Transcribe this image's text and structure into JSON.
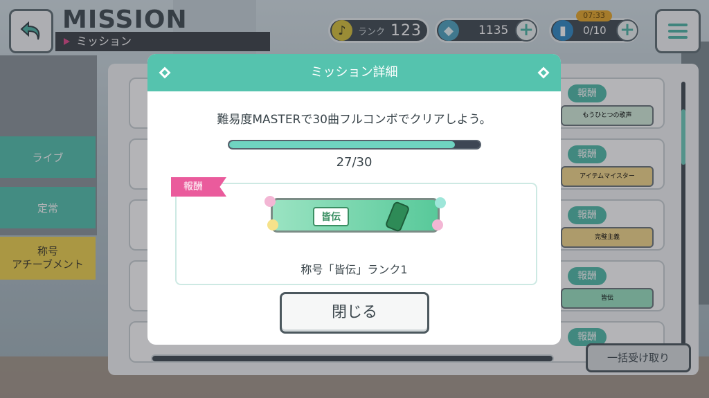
{
  "header": {
    "title": "MISSION",
    "subtitle": "ミッション",
    "rank_label": "ランク",
    "rank_value": "123",
    "gems_value": "1135",
    "stamina_value": "0/10",
    "stamina_timer": "07:33"
  },
  "tabs": [
    {
      "label": "ライブ"
    },
    {
      "label": "定常"
    },
    {
      "label": "称号\nアチーブメント"
    }
  ],
  "list": {
    "reward_chip_label": "報酬",
    "rewards": [
      "もうひとつの歌声",
      "アイテムマイスター",
      "完璧主義",
      "皆伝",
      ""
    ],
    "bulk_receive_label": "一括受け取り"
  },
  "modal": {
    "title": "ミッション詳細",
    "description": "難易度MASTERで30曲フルコンボでクリアしよう。",
    "progress_current": 27,
    "progress_total": 30,
    "progress_text": "27/30",
    "reward_tag": "報酬",
    "reward_badge_text": "皆伝",
    "reward_label": "称号「皆伝」ランク1",
    "close_label": "閉じる"
  },
  "colors": {
    "accent": "#55c3ae",
    "reward_tag": "#ea5b9c",
    "title_tab": "#f0d34e"
  },
  "icons": {
    "back": "back-arrow-icon",
    "rank": "music-note-icon",
    "gems": "crystal-icon",
    "stamina": "energy-drink-icon",
    "menu": "hamburger-menu-icon"
  }
}
